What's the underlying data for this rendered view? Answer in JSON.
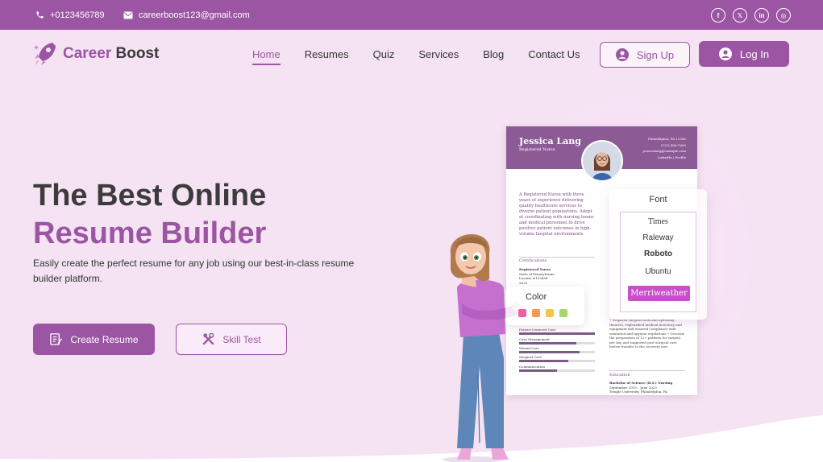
{
  "topbar": {
    "phone": "+0123456789",
    "email": "careerboost123@gmail.com",
    "social": [
      "facebook-icon",
      "x-icon",
      "linkedin-icon",
      "instagram-icon"
    ],
    "social_glyphs": [
      "f",
      "𝕏",
      "in",
      "◎"
    ]
  },
  "brand": {
    "name_part1": "Career",
    "name_part2": "Boost",
    "accent": "#9b55a3"
  },
  "nav": {
    "items": [
      {
        "label": "Home",
        "active": true
      },
      {
        "label": "Resumes"
      },
      {
        "label": "Quiz"
      },
      {
        "label": "Services"
      },
      {
        "label": "Blog"
      },
      {
        "label": "Contact Us"
      }
    ],
    "signup_label": "Sign Up",
    "login_label": "Log In"
  },
  "hero": {
    "title_line1": "The Best Online",
    "title_line2": "Resume Builder",
    "subtitle": "Easily create the perfect resume for any job using our best-in-class resume builder platform.",
    "create_label": "Create Resume",
    "skill_label": "Skill Test"
  },
  "resume": {
    "name": "Jessica Lang",
    "title": "Registered Nurse",
    "contact": [
      "Philadelphia, PA 12345",
      "(123) 456-7890",
      "jessicalang@example.com",
      "LinkedIn | Profile"
    ],
    "summary": "A Registered Nurse with three years of experience delivering quality healthcare services to diverse patient populations. Adept at coordinating with nursing teams and medical personnel to drive positive patient outcomes in high-volume hospital environments.",
    "cert_heading": "Certifications",
    "cert_lines": [
      "Registered Nurse",
      "State of Pennsylvania",
      "License #123456",
      "2023"
    ],
    "skills": [
      {
        "label": "Patient-Centered Care",
        "level": 1.0
      },
      {
        "label": "Case Management",
        "level": 0.75
      },
      {
        "label": "Wound Care",
        "level": 0.8
      },
      {
        "label": "Surgical Care",
        "level": 0.65
      },
      {
        "label": "Communication",
        "level": 0.5
      }
    ],
    "exp_text": "• Prepared surgical tools and operating theaters, replenished medical inventory and equipment and ensured compliance with sanitation and hygiene regulations • Oversaw the preparation of 12+ patients for surgery per day and supported post-surgical care before transfer to the recovery unit",
    "edu_heading": "Education",
    "edu_lines": [
      "Bachelor of Science (B.S.) Nursing",
      "September 2019 – June 2023",
      "Temple University, Philadelphia, PA"
    ]
  },
  "font_panel": {
    "title": "Font",
    "options": [
      "Times",
      "Raleway",
      "Roboto",
      "Ubuntu"
    ],
    "selected": "Merriweather"
  },
  "color_panel": {
    "title": "Color",
    "swatches": [
      "#ee5fa6",
      "#f39a55",
      "#f5c44a",
      "#a8d66b"
    ]
  }
}
